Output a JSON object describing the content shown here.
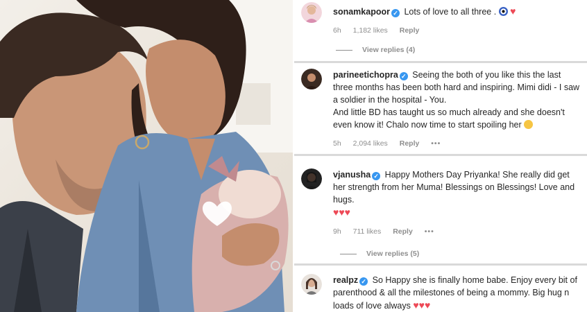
{
  "photo": {
    "description_icon": "family-photo",
    "heart_sticker": "white-heart-icon"
  },
  "comments": [
    {
      "username": "sonamkapoor",
      "verified": true,
      "text": "Lots of love to all three .",
      "emojis": [
        "evil-eye-icon",
        "red-heart-icon"
      ],
      "time": "6h",
      "likes": "1,182 likes",
      "reply_label": "Reply",
      "view_replies": "View replies (4)"
    },
    {
      "username": "parineetichopra",
      "verified": true,
      "text_lines": [
        "Seeing the both of you like this the last three months has been both hard and inspiring. Mimi didi - I saw a soldier in the hospital - You.",
        "And little BD has taught us so much already and she doesn't even know it! Chalo now time to start spoiling her"
      ],
      "emojis": [
        "grinning-face-icon"
      ],
      "time": "5h",
      "likes": "2,094 likes",
      "reply_label": "Reply",
      "more": "•••"
    },
    {
      "username": "vjanusha",
      "verified": true,
      "text": "Happy Mothers Day Priyanka! She really did get her strength from her Muma! Blessings on Blessings! Love and hugs.",
      "hearts": "♥♥♥",
      "time": "9h",
      "likes": "711 likes",
      "reply_label": "Reply",
      "more": "•••",
      "view_replies": "View replies (5)"
    },
    {
      "username": "realpz",
      "verified": true,
      "text": "So Happy she is finally home babe. Enjoy every bit of parenthood & all the milestones of being a mommy. Big hug n loads of love always",
      "hearts": "♥♥♥"
    }
  ],
  "colors": {
    "verified": "#3897f0",
    "heart": "#ed4956",
    "meta": "#8e8e8e",
    "separator": "#d9d9d9"
  }
}
